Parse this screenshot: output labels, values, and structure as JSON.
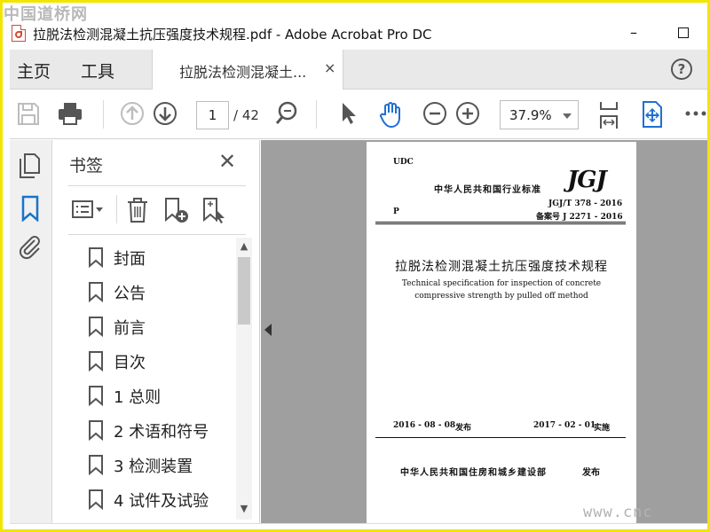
{
  "watermark": {
    "top": "中国道桥网",
    "bottom": "www.cnc"
  },
  "window": {
    "title": "拉脱法检测混凝土抗压强度技术规程.pdf - Adobe Acrobat Pro DC",
    "minimize_glyph": "–",
    "icon": "pdf-file-icon"
  },
  "tabs": {
    "home": "主页",
    "tools": "工具",
    "document": "拉脱法检测混凝土...",
    "close_glyph": "×",
    "help_glyph": "?"
  },
  "toolbar": {
    "current_page": "1",
    "page_total": "/ 42",
    "zoom": "37.9%",
    "icons": [
      "save-icon",
      "print-icon",
      "previous-page-icon",
      "next-page-icon",
      "find-icon",
      "select-pointer-icon",
      "hand-tool-icon",
      "zoom-out-icon",
      "zoom-in-icon",
      "fit-page-icon",
      "scroll-mode-icon",
      "more-tools-icon"
    ]
  },
  "rail": {
    "icons": [
      "page-thumbnails-icon",
      "bookmarks-icon",
      "attachments-icon"
    ]
  },
  "bookmarks": {
    "title": "书签",
    "close_glyph": "✕",
    "tool_icons": [
      "options-menu-icon",
      "delete-bookmark-icon",
      "new-bookmark-icon",
      "bookmark-from-structure-icon"
    ],
    "items": [
      {
        "label": "封面"
      },
      {
        "label": "公告"
      },
      {
        "label": "前言"
      },
      {
        "label": "目次"
      },
      {
        "label": "1 总则"
      },
      {
        "label": "2 术语和符号"
      },
      {
        "label": "3 检测装置"
      },
      {
        "label": "4 试件及试验"
      }
    ]
  },
  "document_page": {
    "udc": "UDC",
    "national_standard": "中华人民共和国行业标准",
    "logo": "JGJ",
    "category": "P",
    "code": "JGJ/T 378 - 2016",
    "filing_code": "备案号 J 2271 - 2016",
    "title_cn": "拉脱法检测混凝土抗压强度技术规程",
    "title_en_line1": "Technical specification for inspection of concrete",
    "title_en_line2": "compressive strength by pulled off method",
    "publish_date": "2016 - 08 - 08",
    "publish_label": "发布",
    "effective_date": "2017 - 02 - 01",
    "effective_label": "实施",
    "issuer": "中华人民共和国住房和城乡建设部",
    "issuer_label": "发布"
  },
  "colors": {
    "frame": "#f2e600",
    "accent_blue": "#1a73c8",
    "active_tool_blue": "#1f6fd1"
  }
}
